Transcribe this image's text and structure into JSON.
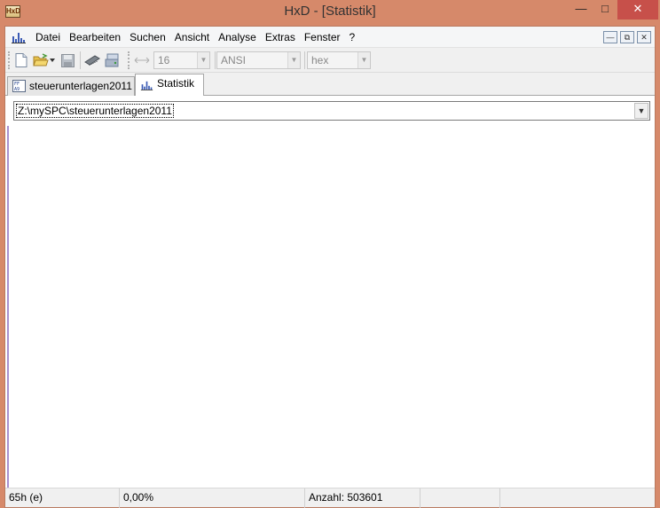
{
  "window": {
    "title": "HxD - [Statistik]",
    "app_icon_text": "HxD"
  },
  "menu": {
    "items": [
      "Datei",
      "Bearbeiten",
      "Suchen",
      "Ansicht",
      "Analyse",
      "Extras",
      "Fenster",
      "?"
    ]
  },
  "toolbar": {
    "bytes_per_row": "16",
    "charset": "ANSI",
    "offset_base": "hex"
  },
  "tabs": [
    {
      "label": "steuerunterlagen2011",
      "icon": "hex-file-icon",
      "active": false
    },
    {
      "label": "Statistik",
      "icon": "statistics-chart-icon",
      "active": true
    }
  ],
  "statistics": {
    "file_path": "Z:\\mySPC\\steuerunterlagen2011"
  },
  "statusbar": {
    "byte": "65h (e)",
    "percent": "0,00%",
    "count": "Anzahl: 503601"
  },
  "colors": {
    "frame": "#d6896a",
    "close_button": "#c7504a",
    "content_background": "#ffffff",
    "accent_bar": "#a890d0"
  }
}
